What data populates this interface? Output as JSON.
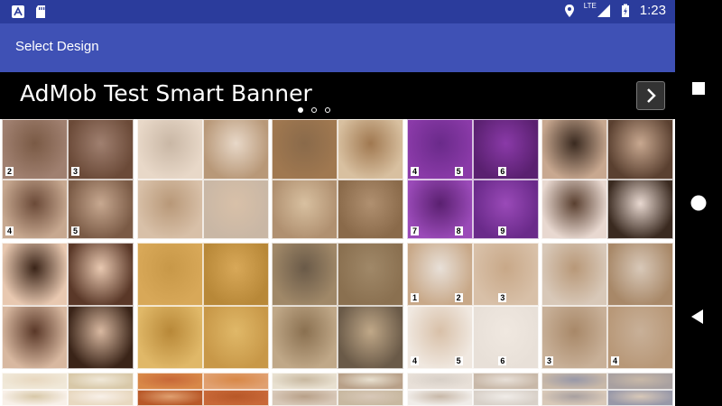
{
  "status_bar": {
    "left_icons": [
      "a-notification-icon",
      "sd-card-icon"
    ],
    "right_icons": [
      "location-icon",
      "lte-signal-icon",
      "battery-charging-icon"
    ],
    "network": "LTE",
    "time": "1:23"
  },
  "app_bar": {
    "title": "Select Design"
  },
  "banner": {
    "text": "AdMob Test Smart Banner",
    "pager": {
      "count": 3,
      "active": 0
    }
  },
  "grid": {
    "tiles": [
      {
        "name": "tile-bun-steps",
        "colors": [
          "#7a5a45",
          "#a08070",
          "#6b4a38",
          "#c7a890"
        ],
        "numbers": [
          "2",
          "3",
          "4",
          "5"
        ]
      },
      {
        "name": "tile-flower-updo",
        "colors": [
          "#c9b7a5",
          "#e8d8c8",
          "#b89878",
          "#d8c0a8"
        ],
        "numbers": []
      },
      {
        "name": "tile-ponytail-twist",
        "colors": [
          "#8a6a4a",
          "#a07850",
          "#d8c0a0",
          "#b09070"
        ],
        "numbers": []
      },
      {
        "name": "tile-purple-braid",
        "colors": [
          "#6a2a8a",
          "#8a3aa8",
          "#5a2070",
          "#9a4ab8"
        ],
        "numbers": [
          "4",
          "5",
          "6",
          "7",
          "8",
          "9"
        ]
      },
      {
        "name": "tile-side-braid",
        "colors": [
          "#3a2a20",
          "#c8a890",
          "#5a4030",
          "#e8d8d0"
        ],
        "numbers": []
      },
      {
        "name": "tile-dark-bun",
        "colors": [
          "#3a2418",
          "#e8c8b0",
          "#5a3828",
          "#d8b8a0"
        ],
        "numbers": []
      },
      {
        "name": "tile-golden-braids",
        "colors": [
          "#c89848",
          "#d8a858",
          "#b88838",
          "#e0b868"
        ],
        "numbers": []
      },
      {
        "name": "tile-braided-crown",
        "colors": [
          "#6a5a48",
          "#a08868",
          "#8a7050",
          "#c0a888"
        ],
        "numbers": []
      },
      {
        "name": "tile-low-bun",
        "colors": [
          "#e8e0d8",
          "#c8a888",
          "#d8c0a8",
          "#f0e8e0"
        ],
        "numbers": [
          "1",
          "2",
          "3",
          "4",
          "5",
          "6"
        ]
      },
      {
        "name": "tile-twisted-half-up",
        "colors": [
          "#b89878",
          "#d8c8b8",
          "#a88868",
          "#c8b098"
        ],
        "numbers": [
          "3",
          "4"
        ]
      },
      {
        "name": "tile-blonde-wave",
        "colors": [
          "#e8d8c0",
          "#f0e8d8",
          "#d8c8a8",
          "#f8f0e8"
        ],
        "numbers": []
      },
      {
        "name": "tile-long-straight",
        "colors": [
          "#c86838",
          "#d88848",
          "#e0a070",
          "#b85828"
        ],
        "numbers": []
      },
      {
        "name": "tile-fishtail",
        "colors": [
          "#c8b8a0",
          "#e8e0d0",
          "#b8a088",
          "#d8c8b8"
        ],
        "numbers": []
      },
      {
        "name": "tile-messy-bun",
        "colors": [
          "#d8d0c8",
          "#e8e0d8",
          "#c8b8a8",
          "#f0ece8"
        ],
        "numbers": []
      },
      {
        "name": "tile-half-updo",
        "colors": [
          "#9898a8",
          "#c8b8a8",
          "#a8a0a0",
          "#d8c8b8"
        ],
        "numbers": []
      }
    ]
  },
  "nav": {
    "recents": "square-recents-icon",
    "home": "circle-home-icon",
    "back": "triangle-back-icon"
  }
}
